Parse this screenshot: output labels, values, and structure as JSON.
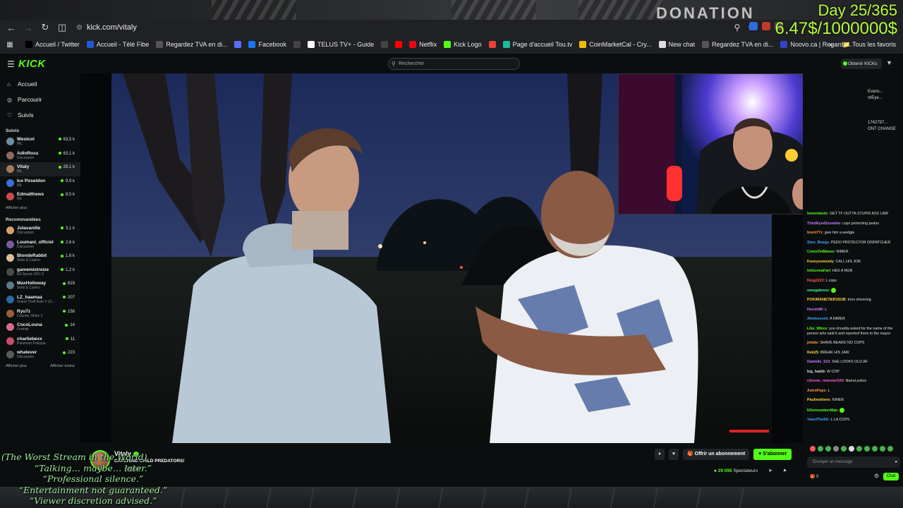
{
  "overlay": {
    "donation_label": "DONATION",
    "day_counter": "Day 25/365",
    "money_counter": "6.47$/1000000$",
    "lines": [
      "(The Worst Stream in the World)",
      "“Talking… maybe… later.”",
      "“Professional silence.”",
      "“Entertainment not guaranteed.”",
      "“Viewer discretion advised.”"
    ]
  },
  "browser": {
    "url": "kick.com/vitaly",
    "bookmarks": [
      {
        "label": "Accueil / Twitter",
        "icon": "x-icon",
        "color": "#000000"
      },
      {
        "label": "Accueil - Télé Fibe",
        "icon": "bell-icon",
        "color": "#1e5bd6"
      },
      {
        "label": "Regardez TVA en di...",
        "icon": "tva-icon",
        "color": "#555555"
      },
      {
        "label": "",
        "icon": "globe-icon",
        "color": "#5b6cff"
      },
      {
        "label": "Facebook",
        "icon": "facebook-icon",
        "color": "#1877f2"
      },
      {
        "label": "",
        "icon": "dollar-icon",
        "color": "#444444"
      },
      {
        "label": "TELUS TV+ - Guide",
        "icon": "telus-icon",
        "color": "#ffffff"
      },
      {
        "label": "",
        "icon": "dollar-icon",
        "color": "#444444"
      },
      {
        "label": "",
        "icon": "youtube-icon",
        "color": "#ff0000"
      },
      {
        "label": "Netflix",
        "icon": "netflix-icon",
        "color": "#e50914"
      },
      {
        "label": "Kick Logo",
        "icon": "kick-icon",
        "color": "#53fc18"
      },
      {
        "label": "",
        "icon": "gmail-icon",
        "color": "#ea4335"
      },
      {
        "label": "Page d'accueil Tou.tv",
        "icon": "toutv-icon",
        "color": "#1abc9c"
      },
      {
        "label": "CoinMarketCal - Cry...",
        "icon": "coin-icon",
        "color": "#f0b90b"
      },
      {
        "label": "New chat",
        "icon": "chat-icon",
        "color": "#dddddd"
      },
      {
        "label": "Regardez TVA en di...",
        "icon": "tva-icon",
        "color": "#555555"
      },
      {
        "label": "Noovo.ca | Regarde...",
        "icon": "noovo-icon",
        "color": "#3344cc"
      }
    ],
    "all_bookmarks": "Tous les favoris"
  },
  "kick": {
    "logo": "KICK",
    "search_placeholder": "Rechercher",
    "get_kicks": "Obtenir KICKs",
    "nav": [
      {
        "label": "Accueil",
        "icon": "home-icon"
      },
      {
        "label": "Parcourir",
        "icon": "compass-icon"
      },
      {
        "label": "Suivis",
        "icon": "heart-icon"
      }
    ],
    "followed_heading": "Suivis",
    "followed": [
      {
        "name": "Westcol",
        "cat": "IRL",
        "viewers": "63,5 k",
        "color": "#6b8fa3"
      },
      {
        "name": "AdinRoss",
        "cat": "Discussion",
        "viewers": "63,1 k",
        "color": "#8a6b5c"
      },
      {
        "name": "Vitaly",
        "cat": "IRL",
        "viewers": "29,1 k",
        "color": "#a37a5c"
      },
      {
        "name": "Ice Poseidon",
        "cat": "IRL",
        "viewers": "9,9 k",
        "color": "#3a6fd8"
      },
      {
        "name": "Edmatthews",
        "cat": "IRL",
        "viewers": "8,5 k",
        "color": "#c94b4b"
      }
    ],
    "show_more": "Afficher plus",
    "recommended_heading": "Recommandées",
    "recommended": [
      {
        "name": "Jolavanille",
        "cat": "Discussion",
        "viewers": "3,1 k",
        "color": "#d9a06b"
      },
      {
        "name": "Loumani_officiel",
        "cat": "Discussion",
        "viewers": "2,6 k",
        "color": "#7a5b9c"
      },
      {
        "name": "BlondeRabbit",
        "cat": "Slots & Casino",
        "viewers": "1,6 k",
        "color": "#e0c09a"
      },
      {
        "name": "gamemixtreize",
        "cat": "EA Sports UFC 5",
        "viewers": "1,2 k",
        "color": "#4a4a4a"
      },
      {
        "name": "MaxHolloway",
        "cat": "Slots & Casino",
        "viewers": "819",
        "color": "#5c7a8a"
      },
      {
        "name": "LZ_haamaa",
        "cat": "Grand Theft Auto V (G...",
        "viewers": "207",
        "color": "#2a6aa3"
      },
      {
        "name": "Ryu7z",
        "cat": "Counter-Strike 2",
        "viewers": "158",
        "color": "#9c5c3a"
      },
      {
        "name": "CocoLouna",
        "cat": "Fortnite",
        "viewers": "14",
        "color": "#d96b8a"
      },
      {
        "name": "charliebexx",
        "cat": "Pokemon Pokopia",
        "viewers": "11",
        "color": "#c94b6b"
      },
      {
        "name": "whatever",
        "cat": "Discussion",
        "viewers": "223",
        "color": "#5a5a5a"
      }
    ],
    "show_more_bottom": "Afficher plus",
    "show_less": "Afficher moins"
  },
  "stream": {
    "streamer": "Vitaly",
    "title": "CATCHING CHILD PREDATORS!",
    "language": "English",
    "subscribe": "Offrir un abonnement",
    "follow": "S'abonner",
    "viewers": "29 095",
    "viewers_label": "Spectateurs"
  },
  "chat": {
    "top_lines": [
      "Evans...",
      "rdEye...",
      "1742797...",
      "ONT CHANGE"
    ],
    "messages": [
      {
        "user": "lemonlandz",
        "color": "#53fc18",
        "text": "GET TF OUTTA STUPID ASS LAW"
      },
      {
        "user": "ThirdEyed2zombie",
        "color": "#c77dff",
        "text": "cops protecting pedos"
      },
      {
        "user": "brent77z",
        "color": "#ff9b3d",
        "text": "give him a wedgie"
      },
      {
        "user": "Ston_Boegs",
        "color": "#3da5ff",
        "text": "PEDO PROTECTOR DISPATCHER"
      },
      {
        "user": "ComeOnManee",
        "color": "#53fc18",
        "text": "NIMER"
      },
      {
        "user": "Koveyssmooty",
        "color": "#ffd23d",
        "text": "CALL HIS JOB"
      },
      {
        "user": "ImGonnaFart",
        "color": "#53fc18",
        "text": "HES A NGR"
      },
      {
        "user": "Klog2222",
        "color": "#ff5a5a",
        "text": "L cops"
      },
      {
        "user": "omegabreez",
        "color": "#3dff9b",
        "text": ""
      },
      {
        "user": "POKIMANETIER3SUB",
        "color": "#ffd23d",
        "text": "bros shivering"
      },
      {
        "user": "Hershi80",
        "color": "#c77dff",
        "text": "L"
      },
      {
        "user": "Aleeksoveb",
        "color": "#3da5ff",
        "text": "A NIMER"
      },
      {
        "user": "Like_Mikes",
        "color": "#53fc18",
        "text": "you shoulda asked for the name of the person who said it and reported them to the mayor"
      },
      {
        "user": "jmtale",
        "color": "#ff9b3d",
        "text": "SHAVE BEARD NO COPS"
      },
      {
        "user": "Reb25",
        "color": "#ffd23d",
        "text": "BREAK HIS JAW"
      },
      {
        "user": "Danielle_510",
        "color": "#c77dff",
        "text": "SHE LOOKS OLD AF"
      },
      {
        "user": "big_habib",
        "color": "#dddddd",
        "text": "W COP"
      },
      {
        "user": "citronic_monster530",
        "color": "#ff5ad2",
        "text": "liberal police"
      },
      {
        "user": "AstroPeps",
        "color": "#ff9b3d",
        "text": "L"
      },
      {
        "user": "Paulinobiees",
        "color": "#ffd23d",
        "text": "NINER"
      },
      {
        "user": "N3onnumberMan",
        "color": "#53fc18",
        "text": ""
      },
      {
        "user": "YanniThe0G",
        "color": "#3da5ff",
        "text": "L LA COPS"
      }
    ],
    "input_placeholder": "Envoyer un message",
    "send_button": "Chat",
    "points": "0"
  }
}
